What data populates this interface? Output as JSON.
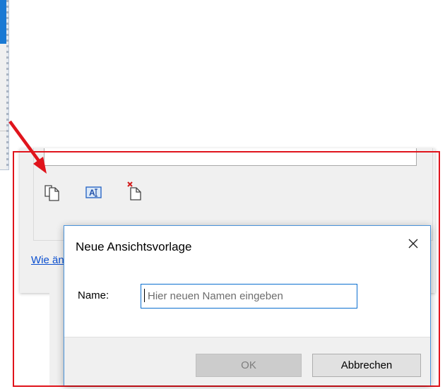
{
  "dialog": {
    "title": "Neue Ansichtsvorlage",
    "name_label": "Name:",
    "name_placeholder": "Hier neuen Namen eingeben",
    "name_value": "",
    "ok_label": "OK",
    "cancel_label": "Abbrechen",
    "ok_enabled": false
  },
  "background": {
    "link_text": "Wie ändere ich die Ansicht?",
    "toolbar_icons": [
      "copy-icon",
      "rename-icon",
      "delete-icon"
    ]
  },
  "colors": {
    "highlight": "#e0141c",
    "dialog_border": "#4a93da",
    "input_border": "#0b6fd0",
    "link": "#0b4fd0",
    "selection": "#1979d4"
  }
}
